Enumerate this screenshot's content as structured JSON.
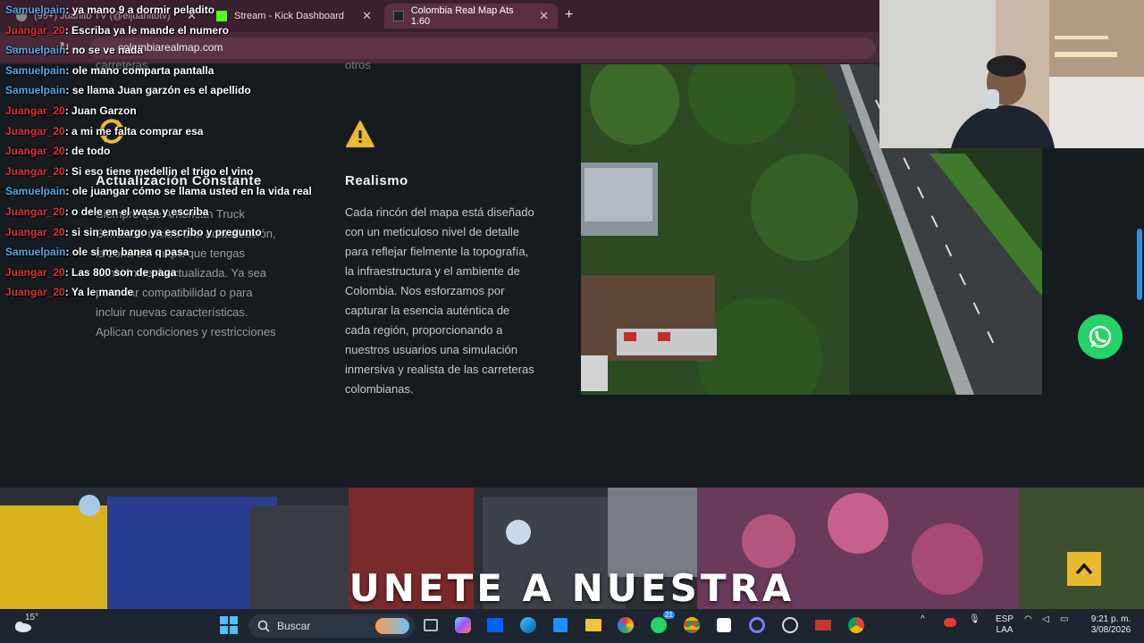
{
  "browser": {
    "tabs": [
      {
        "label": "(99+) Juanito TV (@eljuanitotv)"
      },
      {
        "label": "Stream - Kick Dashboard"
      },
      {
        "label": "Colombia Real Map Ats 1.60"
      }
    ],
    "new_tab": "+",
    "url": "colombiarealmap.com"
  },
  "features": {
    "top_fragment_left": "carreteras",
    "top_fragment_mid": "otros",
    "left": {
      "title": "Actualización Constante",
      "text_lines": [
        "Siempre que American Truck",
        "Simulator reciba una actualización,",
        "la zona del mapa que tengas",
        "también será actualizada. Ya sea",
        "para dar compatibilidad o para",
        "incluir nuevas características.",
        "Aplican condiciones y restricciones"
      ]
    },
    "middle": {
      "title": "Realismo",
      "text_lines": [
        "Cada rincón del mapa está diseñado",
        "con un meticuloso nivel de detalle",
        "para reflejar fielmente la topografía,",
        "la infraestructura y el ambiente de",
        "Colombia. Nos esforzamos por",
        "capturar la esencia auténtica de",
        "cada región, proporcionando a",
        "nuestros usuarios una simulación",
        "inmersiva y realista de las carreteras",
        "colombianas."
      ]
    }
  },
  "banner": {
    "title": "UNETE A NUESTRA"
  },
  "chat": [
    {
      "user": "Samuelpain",
      "color": "blue",
      "msg": ": ya mano 9 a dormir peladito"
    },
    {
      "user": "Juangar_20",
      "color": "red",
      "msg": ": Escriba ya le mande el numero"
    },
    {
      "user": "Samuelpain",
      "color": "blue",
      "msg": ": no se ve nada"
    },
    {
      "user": "Samuelpain",
      "color": "blue",
      "msg": ": ole mano comparta pantalla"
    },
    {
      "user": "Samuelpain",
      "color": "blue",
      "msg": ": se llama Juan garzón es el apellido"
    },
    {
      "user": "Juangar_20",
      "color": "red",
      "msg": ": Juan Garzon"
    },
    {
      "user": "Juangar_20",
      "color": "red",
      "msg": ": a mi me falta comprar esa"
    },
    {
      "user": "Juangar_20",
      "color": "red",
      "msg": ": de todo"
    },
    {
      "user": "Juangar_20",
      "color": "red",
      "msg": ": Si eso tiene medellin el trigo el vino"
    },
    {
      "user": "Samuelpain",
      "color": "blue",
      "msg": ": ole juangar cómo se llama usted en la vida real"
    },
    {
      "user": "Juangar_20",
      "color": "red",
      "msg": ": o dele en el wasa y escriba"
    },
    {
      "user": "Juangar_20",
      "color": "red",
      "msg": ": si sin embargo ya escribo y pregunto"
    },
    {
      "user": "Samuelpain",
      "color": "blue",
      "msg": ": ole si me banea q pasa"
    },
    {
      "user": "Juangar_20",
      "color": "red",
      "msg": ": Las 800 son de paga"
    },
    {
      "user": "Juangar_20",
      "color": "red",
      "msg": ": Ya le mande"
    }
  ],
  "taskbar": {
    "temperature": "15°",
    "search_label": "Buscar",
    "language": "ESP",
    "layout": "LAA",
    "time": "9:21 p. m.",
    "date": "3/08/2026",
    "badge": "21"
  },
  "colors": {
    "accent_yellow": "#e9b930",
    "whatsapp_green": "#25d366",
    "chat_blue": "#5aa6e6",
    "chat_red": "#e0313a"
  }
}
